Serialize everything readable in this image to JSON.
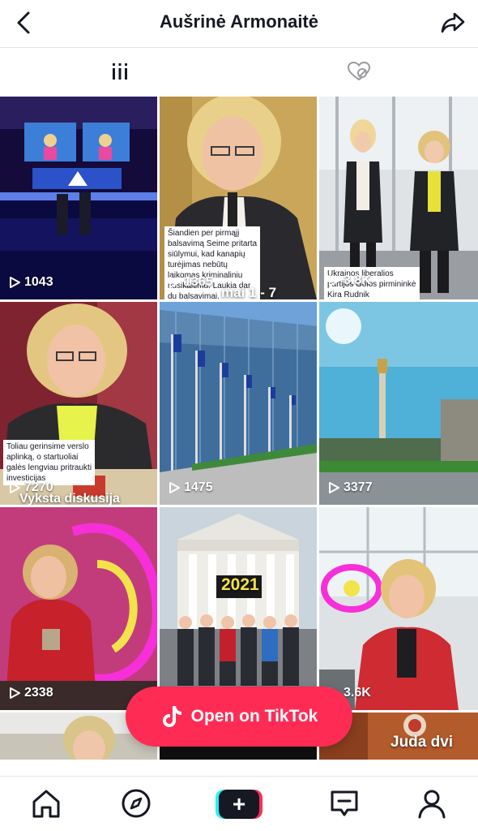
{
  "header": {
    "title": "Aušrinė Armonaitė",
    "back_icon": "chevron-left-icon",
    "share_icon": "share-arrow-icon"
  },
  "tabs": [
    {
      "name": "videos",
      "icon": "grid-bars-icon",
      "active": true
    },
    {
      "name": "liked",
      "icon": "hidden-heart-icon",
      "active": false
    }
  ],
  "videos": [
    {
      "views": "1043"
    },
    {
      "views": "1365",
      "caption": [
        "Šiandien per pirmąjį",
        "balsavimą Seime pritarta",
        "siūlymui, kad kanapių",
        "turėjimas nebūtų",
        "laikomas kriminaliniu",
        "nusikaltimu. Laukia dar",
        "du balsavimai."
      ],
      "overlay": "mai 1 - 7"
    },
    {
      "views": "3.8K",
      "caption": [
        "Ukrainos liberalios",
        "partijos Golos pirmininkė",
        "Kira Rudnik"
      ]
    },
    {
      "views": "7270",
      "caption": [
        "Toliau gerinsime verslo",
        "aplinką, o startuoliai",
        "galės lengviau pritraukti",
        "investicijas"
      ],
      "overlay": "Vyksta diskusija"
    },
    {
      "views": "1475"
    },
    {
      "views": "3377"
    },
    {
      "views": "2338"
    },
    {
      "views": "",
      "overlay": "2021"
    },
    {
      "views": "3.6K"
    },
    {
      "views": ""
    },
    {
      "views": ""
    },
    {
      "views": "",
      "overlay": "Juda dvi"
    }
  ],
  "open_button": {
    "label": "Open on TikTok",
    "icon": "tiktok-logo-icon"
  },
  "bottom_nav": [
    {
      "name": "home",
      "icon": "home-icon"
    },
    {
      "name": "discover",
      "icon": "compass-icon"
    },
    {
      "name": "create",
      "icon": "plus-icon",
      "label": "+"
    },
    {
      "name": "inbox",
      "icon": "inbox-message-icon"
    },
    {
      "name": "profile",
      "icon": "person-icon"
    }
  ],
  "colors": {
    "accent": "#fe2c55",
    "cyan": "#25f4ee",
    "text": "#161823"
  }
}
